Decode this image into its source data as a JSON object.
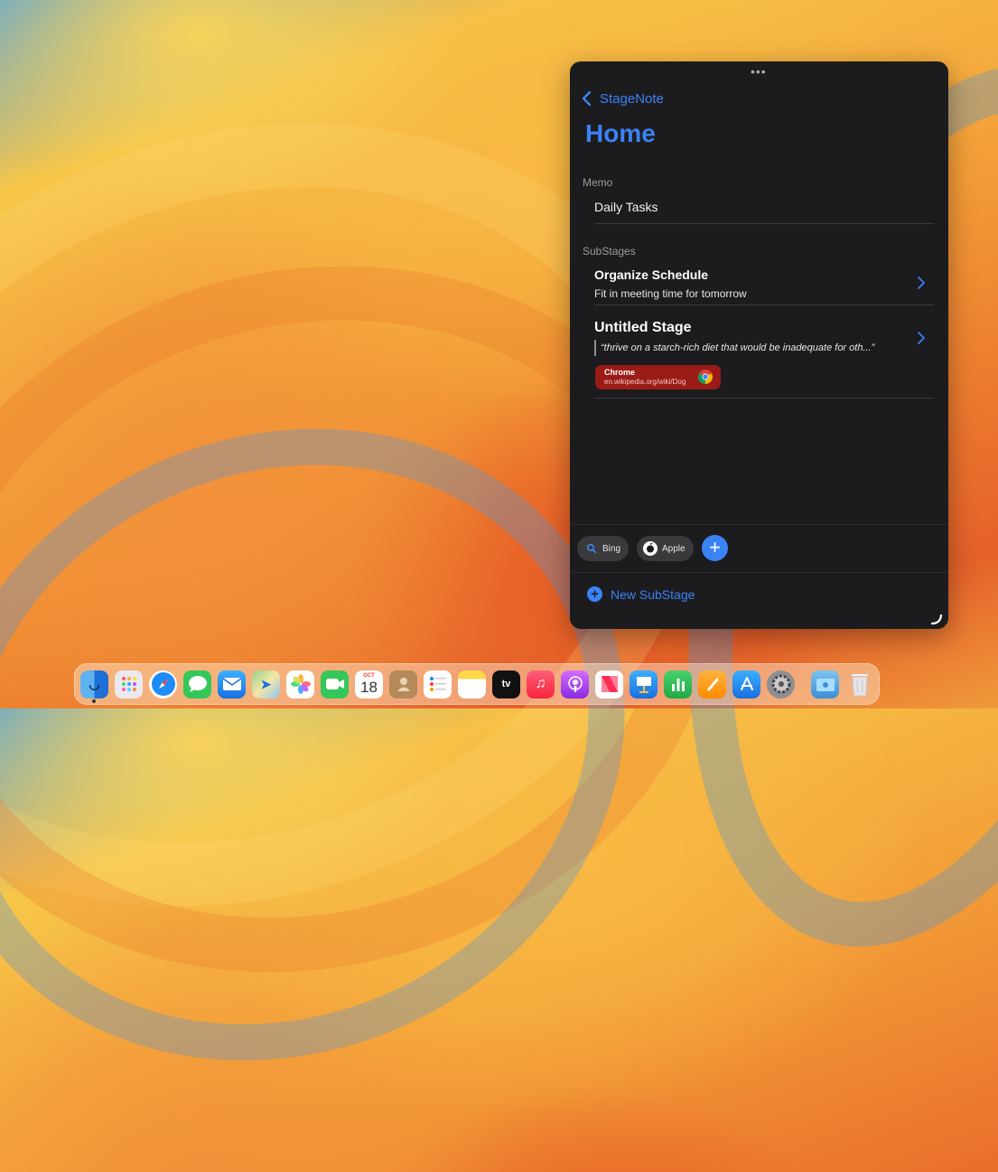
{
  "window": {
    "back_label": "StageNote",
    "title": "Home",
    "memo_section": "Memo",
    "memo_item": "Daily Tasks",
    "substages_section": "SubStages",
    "substages": [
      {
        "title": "Organize Schedule",
        "description": "Fit in meeting time for tomorrow"
      },
      {
        "title": "Untitled Stage",
        "quote": "“thrive on a starch-rich diet that would be inadequate for oth...”",
        "link": {
          "app": "Chrome",
          "url": "en.wikipedia.org/wiki/Dog"
        }
      }
    ],
    "bookmarks": [
      {
        "label": "Bing",
        "icon": "search-icon"
      },
      {
        "label": "Apple",
        "icon": "apple-icon"
      }
    ],
    "new_substage_label": "New SubStage",
    "accent_color": "#3b82f6",
    "link_color": "#9b1b16"
  },
  "dock": {
    "calendar_month": "OCT",
    "calendar_day": "18",
    "tv_label": "tv",
    "apps": [
      "Finder",
      "Launchpad",
      "Safari",
      "Messages",
      "Mail",
      "Maps",
      "Photos",
      "FaceTime",
      "Calendar",
      "Contacts",
      "Reminders",
      "Notes",
      "TV",
      "Music",
      "Podcasts",
      "News",
      "Keynote",
      "Numbers",
      "Pages",
      "App Store",
      "System Settings",
      "Downloads",
      "Trash"
    ]
  }
}
